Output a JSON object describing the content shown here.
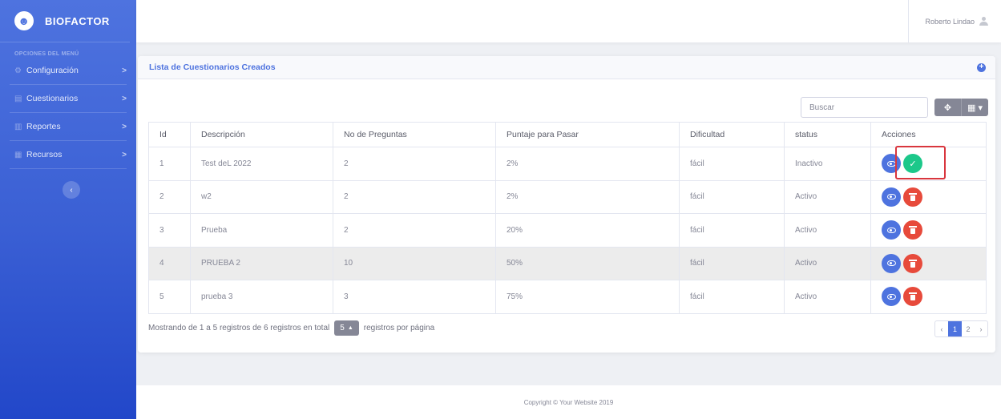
{
  "brand": {
    "name": "BIOFACTOR"
  },
  "sidebar": {
    "heading": "OPCIONES DEL MENÚ",
    "items": [
      {
        "label": "Configuración",
        "icon": "gear-icon"
      },
      {
        "label": "Cuestionarios",
        "icon": "table-icon"
      },
      {
        "label": "Reportes",
        "icon": "chart-icon"
      },
      {
        "label": "Recursos",
        "icon": "list-icon"
      }
    ],
    "chevron": ">",
    "collapse": "‹"
  },
  "topbar": {
    "user_name": "Roberto Lindao"
  },
  "card": {
    "title": "Lista de Cuestionarios Creados",
    "search_placeholder": "Buscar",
    "columns": [
      "Id",
      "Descripción",
      "No de Preguntas",
      "Puntaje para Pasar",
      "Dificultad",
      "status",
      "Acciones"
    ],
    "rows": [
      {
        "id": "1",
        "desc": "Test deL 2022",
        "preguntas": "2",
        "puntaje": "2%",
        "dificultad": "fácil",
        "status": "Inactivo"
      },
      {
        "id": "2",
        "desc": "w2",
        "preguntas": "2",
        "puntaje": "2%",
        "dificultad": "fácil",
        "status": "Activo"
      },
      {
        "id": "3",
        "desc": "Prueba",
        "preguntas": "2",
        "puntaje": "20%",
        "dificultad": "fácil",
        "status": "Activo"
      },
      {
        "id": "4",
        "desc": "PRUEBA 2",
        "preguntas": "10",
        "puntaje": "50%",
        "dificultad": "fácil",
        "status": "Activo"
      },
      {
        "id": "5",
        "desc": "prueba 3",
        "preguntas": "3",
        "puntaje": "75%",
        "dificultad": "fácil",
        "status": "Activo"
      }
    ],
    "info_text": "Mostrando de 1 a 5 registros de 6 registros en total",
    "page_size": "5",
    "per_page_text": "registros por página",
    "pager": {
      "prev": "‹",
      "pages": [
        "1",
        "2"
      ],
      "next": "›",
      "active": "1"
    }
  },
  "footer": {
    "copyright": "Copyright © Your Website 2019"
  },
  "colors": {
    "primary": "#4e73df",
    "danger": "#e74a3b",
    "success": "#1cc88a",
    "highlight": "#d9363e"
  }
}
